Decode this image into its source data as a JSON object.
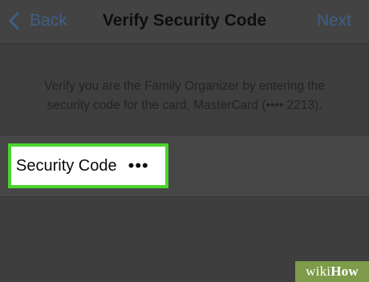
{
  "nav": {
    "back_label": "Back",
    "title": "Verify Security Code",
    "next_label": "Next",
    "accent_color": "#3f5f86"
  },
  "instructions": {
    "line1": "Verify you are the Family Organizer by entering the",
    "line2": "security code for the card, MasterCard (•••• 2213)."
  },
  "security_field": {
    "label": "Security Code",
    "value": "•••",
    "highlight_color": "#4bd42e"
  },
  "watermark": {
    "prefix": "wiki",
    "suffix": "How"
  }
}
